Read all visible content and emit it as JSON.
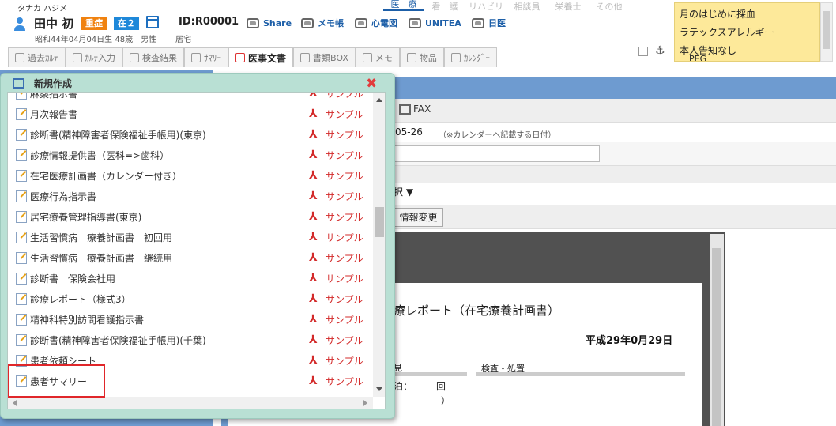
{
  "patient": {
    "kana": "タナカ ハジメ",
    "name": "田中 初",
    "badge_severity": "重症",
    "badge_home": "在２",
    "id": "ID:R00001",
    "details": "昭和44年04月04日生 48歳　男性",
    "residence": "居宅"
  },
  "tools": [
    {
      "label": "Share",
      "icon": "share-icon"
    },
    {
      "label": "メモ帳",
      "icon": "memo-icon"
    },
    {
      "label": "心電図",
      "icon": "ecg-icon"
    },
    {
      "label": "UNITEA",
      "icon": "unitea-icon"
    },
    {
      "label": "日医",
      "icon": "nichii-icon"
    }
  ],
  "role_tabs": [
    "医　療",
    "看　護",
    "リハビリ",
    "相談員",
    "栄養士",
    "その他"
  ],
  "notes": [
    "月のはじめに採血",
    "ラテックスアレルギー",
    "本人告知なし",
    "PEG"
  ],
  "main_tabs": [
    "過去ｶﾙﾃ",
    "ｶﾙﾃ入力",
    "検査結果",
    "ｻﾏﾘｰ",
    "医事文書",
    "書類BOX",
    "メモ",
    "物品",
    "ｶﾚﾝﾀﾞｰ"
  ],
  "active_main_tab": "医事文書",
  "colors": {
    "accent": "#1d5fa8",
    "dialog_bg": "#b9e0d4",
    "pdf_red": "#d32a2a",
    "highlight": "#e0262a"
  },
  "dialog": {
    "title": "新規作成",
    "sample_label": "サンプル",
    "items": [
      "麻薬指示書",
      "月次報告書",
      "診断書(精神障害者保険福祉手帳用)(東京)",
      "診療情報提供書（医科=>歯科）",
      "在宅医療計画書（カレンダー付き）",
      "医療行為指示書",
      "居宅療養管理指導書(東京)",
      "生活習慣病　療養計画書　初回用",
      "生活習慣病　療養計画書　継続用",
      "診断書　保険会社用",
      "診療レポート（様式3）",
      "精神科特別訪問看護指示書",
      "診断書(精神障害者保険福祉手帳用)(千葉)",
      "患者依頼シート",
      "患者サマリー"
    ]
  },
  "form": {
    "fax_label": "FAX",
    "date_value": "05-26",
    "date_note": "（※カレンダーへ記載する日付）",
    "select_value": "択",
    "change_button": "情報変更"
  },
  "preview": {
    "title": "療レポート（在宅療養計画書）",
    "date": "平成29年0月29日",
    "label_left": "見",
    "label_right": "検査・処置",
    "value_1": "泊：",
    "value_2": "回",
    "value_3": "）"
  }
}
